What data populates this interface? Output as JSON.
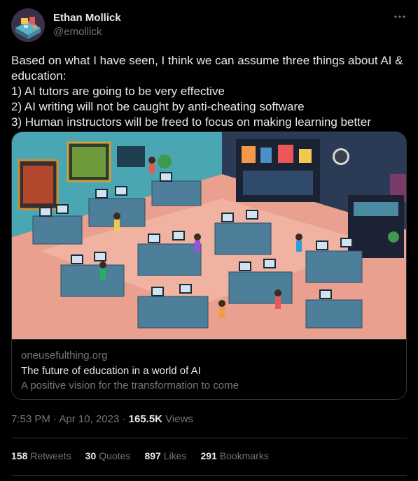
{
  "author": {
    "display_name": "Ethan Mollick",
    "handle": "@emollick"
  },
  "more_icon": "more-dots-icon",
  "tweet": {
    "text": "Based on what I have seen, I think we can assume three things about AI & education:\n1) AI tutors are going to be very effective\n2) AI writing will not be caught by anti-cheating software\n3) Human instructors will be freed to focus on making learning better"
  },
  "link_card": {
    "domain": "oneusefulthing.org",
    "title": "The future of education in a world of AI",
    "description": "A positive vision for the transformation to come"
  },
  "meta": {
    "time": "7:53 PM",
    "separator": " · ",
    "date": "Apr 10, 2023",
    "views_count": "165.5K",
    "views_label": " Views"
  },
  "stats": [
    {
      "count": "158",
      "label": "Retweets"
    },
    {
      "count": "30",
      "label": "Quotes"
    },
    {
      "count": "897",
      "label": "Likes"
    },
    {
      "count": "291",
      "label": "Bookmarks"
    }
  ],
  "colors": {
    "background": "#000000",
    "text_primary": "#e7e9ea",
    "text_secondary": "#71767b",
    "border": "#2f3336"
  }
}
